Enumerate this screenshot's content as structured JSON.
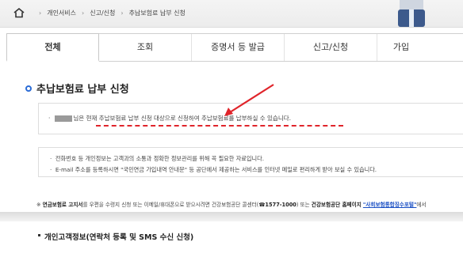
{
  "breadcrumb": {
    "home_icon": "home-icon",
    "items": [
      "개인서비스",
      "신고/신청",
      "추납보험료 납부 신청"
    ]
  },
  "tabs": [
    "전체",
    "조회",
    "증명서 등 발급",
    "신고/신청",
    "가입"
  ],
  "page_title": "추납보험료 납부 신청",
  "notice": {
    "message": "님은 현재 추납보험료 납부 신청 대상으로 신청하여 추납보험료를 납부하실 수 있습니다."
  },
  "info": {
    "line1": "전화번호 등 개인정보는 고객과의 소통과 정확한 정보관리를 위해 꼭 필요한 자료입니다.",
    "line2": "E-mail 주소를 등록하시면 \"국민연금 가입내역 안내문\" 등 공단에서 제공하는 서비스를 인터넷 메일로 편리하게 받아 보실 수 있습니다."
  },
  "footnote": {
    "prefix": "※",
    "bold1": "연금보험료 고지서",
    "text1": "를 우편을 수령지 신청 또는 이메일/휴대폰으로 받으시려면 건강보험공단 콜센터(",
    "phone": "☎1577-1000",
    "text2": ") 또는",
    "bold2": "건강보험공단 홈페이지",
    "link": "\"사회보험통합징수포털\"",
    "text3": "에서"
  },
  "section": {
    "label": "개인고객정보(연락처 등록 및 SMS 수신 신청)"
  },
  "colors": {
    "accent": "#2b6cd6",
    "annotation": "#e0242a"
  }
}
